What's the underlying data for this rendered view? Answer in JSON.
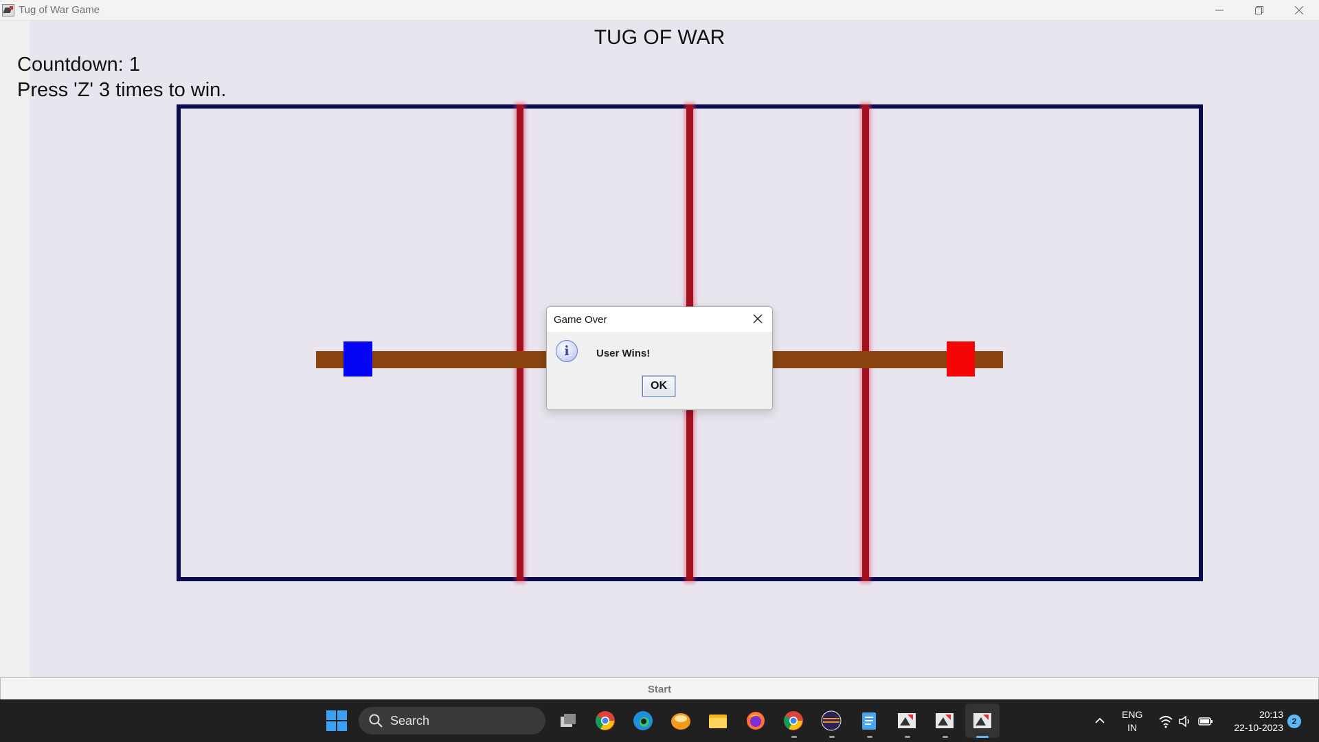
{
  "window": {
    "title": "Tug of War Game"
  },
  "game": {
    "title": "TUG OF WAR",
    "countdown": "Countdown: 1",
    "instruction": "Press 'Z' 3 times to win.",
    "start_label": "Start",
    "colors": {
      "field_border": "#0a0a52",
      "marker": "#a5101f",
      "rope": "#8b4513",
      "player_left": "#0505f5",
      "player_right": "#f50505"
    }
  },
  "dialog": {
    "title": "Game Over",
    "message": "User Wins!",
    "ok_label": "OK",
    "icon": "info-icon"
  },
  "taskbar": {
    "search_label": "Search",
    "pinned_apps": [
      "task-view-icon",
      "chrome-icon",
      "edge-icon",
      "app-orange-icon",
      "file-explorer-icon",
      "firefox-icon",
      "chrome-profile-icon",
      "eclipse-icon",
      "notepad-icon",
      "java-app-icon",
      "java-app-icon",
      "java-app-icon"
    ],
    "tray": {
      "lang_top": "ENG",
      "lang_bottom": "IN",
      "time": "20:13",
      "date": "22-10-2023",
      "notification_count": "2"
    }
  }
}
